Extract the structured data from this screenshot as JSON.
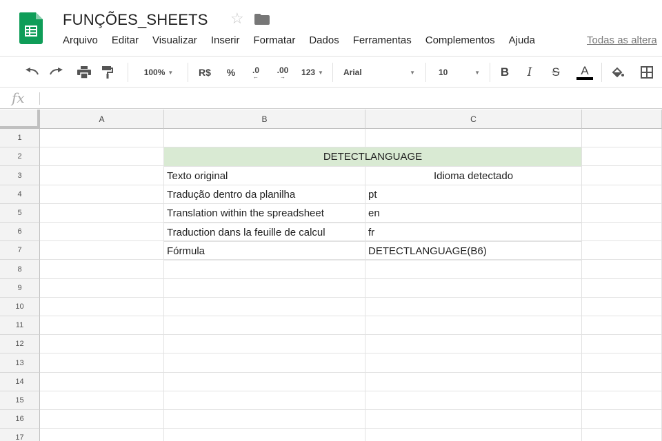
{
  "header": {
    "title": "FUNÇÕES_SHEETS",
    "all_changes": "Todas as altera",
    "menu": [
      "Arquivo",
      "Editar",
      "Visualizar",
      "Inserir",
      "Formatar",
      "Dados",
      "Ferramentas",
      "Complementos",
      "Ajuda"
    ]
  },
  "toolbar": {
    "zoom": "100%",
    "currency": "R$",
    "percent": "%",
    "decrease_decimals": ".0",
    "increase_decimals": ".00",
    "more_formats": "123",
    "font": "Arial",
    "font_size": "10",
    "bold": "B",
    "italic": "I",
    "strikethrough": "S",
    "text_color_letter": "A"
  },
  "formula_bar": {
    "label": "fx",
    "value": ""
  },
  "grid": {
    "columns": [
      "A",
      "B",
      "C"
    ],
    "rows": [
      "1",
      "2",
      "3",
      "4",
      "5",
      "6",
      "7",
      "8",
      "9",
      "10",
      "11",
      "12",
      "13",
      "14",
      "15",
      "16",
      "17"
    ],
    "merged_header": "DETECTLANGUAGE",
    "col_b_header": "Texto original",
    "col_c_header": "Idioma detectado",
    "data": [
      {
        "text": "Tradução dentro da planilha",
        "lang": "pt"
      },
      {
        "text": "Translation within the spreadsheet",
        "lang": "en"
      },
      {
        "text": "Traduction dans la feuille de calcul",
        "lang": "fr"
      },
      {
        "text": "Fórmula",
        "lang": "DETECTLANGUAGE(B6)"
      }
    ]
  },
  "colors": {
    "merged_fill": "#d9ead3",
    "logo_green": "#0f9d58",
    "header_bg": "#f3f3f3"
  }
}
